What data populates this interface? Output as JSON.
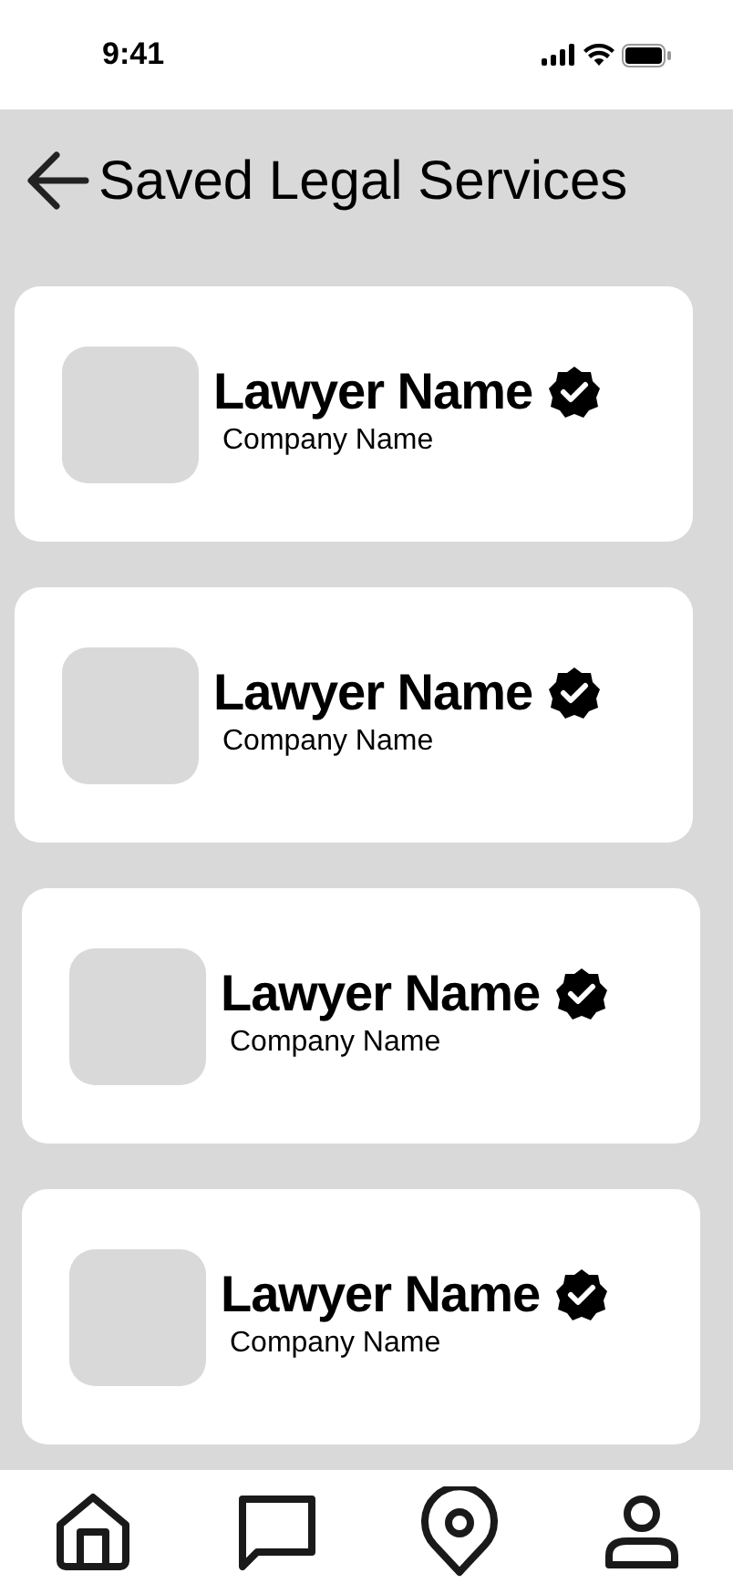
{
  "status_bar": {
    "time": "9:41"
  },
  "header": {
    "title": "Saved Legal Services"
  },
  "lawyers": [
    {
      "name": "Lawyer Name",
      "company": "Company Name",
      "verified": true
    },
    {
      "name": "Lawyer Name",
      "company": "Company Name",
      "verified": true
    },
    {
      "name": "Lawyer Name",
      "company": "Company Name",
      "verified": true
    },
    {
      "name": "Lawyer Name",
      "company": "Company Name",
      "verified": true
    }
  ]
}
